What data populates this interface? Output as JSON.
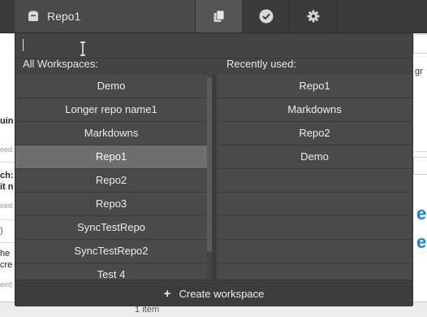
{
  "topbar": {
    "repo_label": "Repo1",
    "repo_icon": "repository-icon",
    "tools": [
      "repositories-icon",
      "check-circle-icon",
      "gear-icon"
    ]
  },
  "popup": {
    "search": {
      "value": "",
      "placeholder": ""
    },
    "all_title": "All Workspaces:",
    "recent_title": "Recently used:",
    "all_workspaces": [
      {
        "label": "Demo",
        "selected": false
      },
      {
        "label": "Longer repo name1",
        "selected": false
      },
      {
        "label": "Markdowns",
        "selected": false
      },
      {
        "label": "Repo1",
        "selected": true
      },
      {
        "label": "Repo2",
        "selected": false
      },
      {
        "label": "Repo3",
        "selected": false
      },
      {
        "label": "SyncTestRepo",
        "selected": false
      },
      {
        "label": "SyncTestRepo2",
        "selected": false
      },
      {
        "label": "Test 4",
        "selected": false
      }
    ],
    "recently_used": [
      "Repo1",
      "Markdowns",
      "Repo2",
      "Demo"
    ],
    "create_label": "Create workspace"
  },
  "background": {
    "left_fragments": [
      "uin",
      "eed",
      "ch:",
      "it n",
      "eed",
      ")",
      "he",
      "cre",
      "eed"
    ],
    "right_fragments": [
      "gr",
      "e",
      "e"
    ],
    "bottom_text": "1 item"
  },
  "colors": {
    "accent_blue": "#1a7fd4",
    "selected_row": "#6e6e6e",
    "popup_bg": "#444444"
  }
}
